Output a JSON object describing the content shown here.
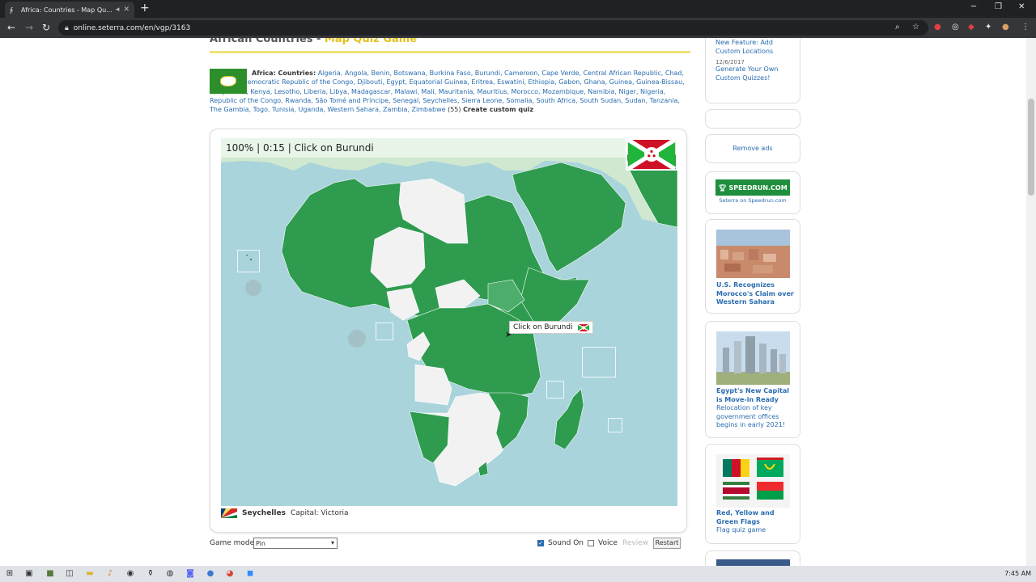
{
  "browser": {
    "tab_title": "Africa: Countries - Map Qu...",
    "url": "online.seterra.com/en/vgp/3163"
  },
  "page": {
    "heading": "African Countries",
    "heading_sub": "Map Quiz Game",
    "countries_label": "Africa: Countries:",
    "countries_list": "Algeria, Angola, Benin, Botswana, Burkina Faso, Burundi, Cameroon, Cape Verde, Central African Republic, Chad, Comoros, Democratic Republic of the Congo, Djibouti, Egypt, Equatorial Guinea, Eritrea, Eswatini, Ethiopia, Gabon, Ghana, Guinea, Guinea-Bissau, Ivory Coast, Kenya, Lesotho, Liberia, Libya, Madagascar, Malawi, Mali, Mauritania, Mauritius, Morocco, Mozambique, Namibia, Niger, Nigeria, Republic of the Congo, Rwanda, São Tomé and Príncipe, Senegal, Seychelles, Sierra Leone, Somalia, South Africa, South Sudan, Sudan, Tanzania, The Gambia, Togo, Tunisia, Uganda, Western Sahara, Zambia, Zimbabwe",
    "countries_count": "(55)",
    "create_custom": "Create custom quiz"
  },
  "quiz": {
    "status": "100% | 0:15 | Click on Burundi",
    "hint": "Click on Burundi",
    "info_country": "Seychelles",
    "info_capital": "Capital: Victoria"
  },
  "controls": {
    "mode_label": "Game mode:",
    "mode_value": "Pin",
    "sound_label": "Sound On",
    "sound_checked": true,
    "voice_label": "Voice",
    "voice_checked": false,
    "review_label": "Review",
    "restart_label": "Restart"
  },
  "sidebar": {
    "news1": "New Feature: Add Custom Locations",
    "news2_date": "12/6/2017",
    "news2": "Generate Your Own Custom Quizzes!",
    "remove_ads": "Remove ads",
    "speedrun_logo": "SPEEDRUN.COM",
    "speedrun_caption": "Seterra on Speedrun.com",
    "article1_title": "U.S. Recognizes Morocco's Claim over Western Sahara",
    "article2_title": "Egypt's New Capital is Move-in Ready",
    "article2_sub": "Relocation of key government offices begins in early 2021!",
    "article3_title": "Red, Yellow and Green Flags",
    "article3_sub": "Flag quiz game"
  },
  "taskbar": {
    "time": "7:45 AM"
  },
  "colors": {
    "map_green": "#2e9b4e",
    "map_white": "#f2f2f2",
    "ocean": "#a9d4dc",
    "link": "#2a6db0"
  }
}
